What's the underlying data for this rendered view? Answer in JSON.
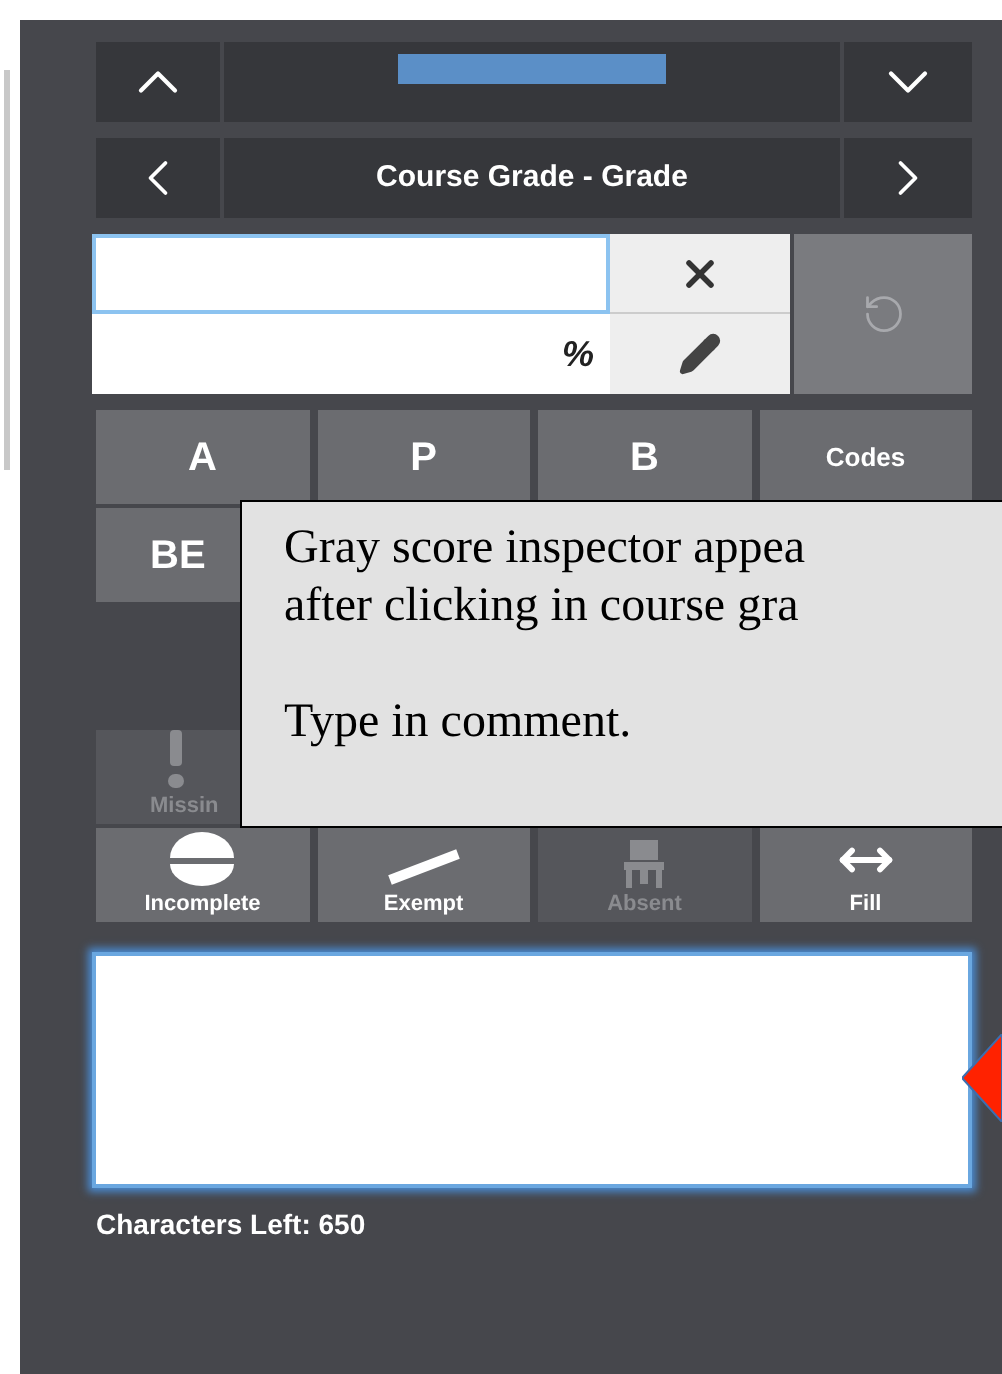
{
  "assignment_nav": {
    "title": "Course Grade - Grade"
  },
  "score": {
    "percent_symbol": "%"
  },
  "grade_buttons": [
    {
      "label": "A",
      "kind": "grade"
    },
    {
      "label": "P",
      "kind": "grade"
    },
    {
      "label": "B",
      "kind": "grade"
    },
    {
      "label": "Codes",
      "kind": "codes"
    }
  ],
  "grade_buttons_row2": [
    {
      "label": "BE"
    }
  ],
  "flag_buttons_row1": [
    {
      "label": "Missin",
      "kind": "missing",
      "disabled": true
    }
  ],
  "flag_buttons": [
    {
      "label": "Incomplete",
      "kind": "incomplete",
      "disabled": false
    },
    {
      "label": "Exempt",
      "kind": "exempt",
      "disabled": false
    },
    {
      "label": "Absent",
      "kind": "absent",
      "disabled": true
    },
    {
      "label": "Fill",
      "kind": "fill",
      "disabled": false
    }
  ],
  "comment": {
    "focused": true
  },
  "characters_left": "Characters Left: 650",
  "callout": {
    "lines": [
      "Gray score inspector appea",
      "after clicking in course gra"
    ],
    "last_line": "Type in comment."
  }
}
